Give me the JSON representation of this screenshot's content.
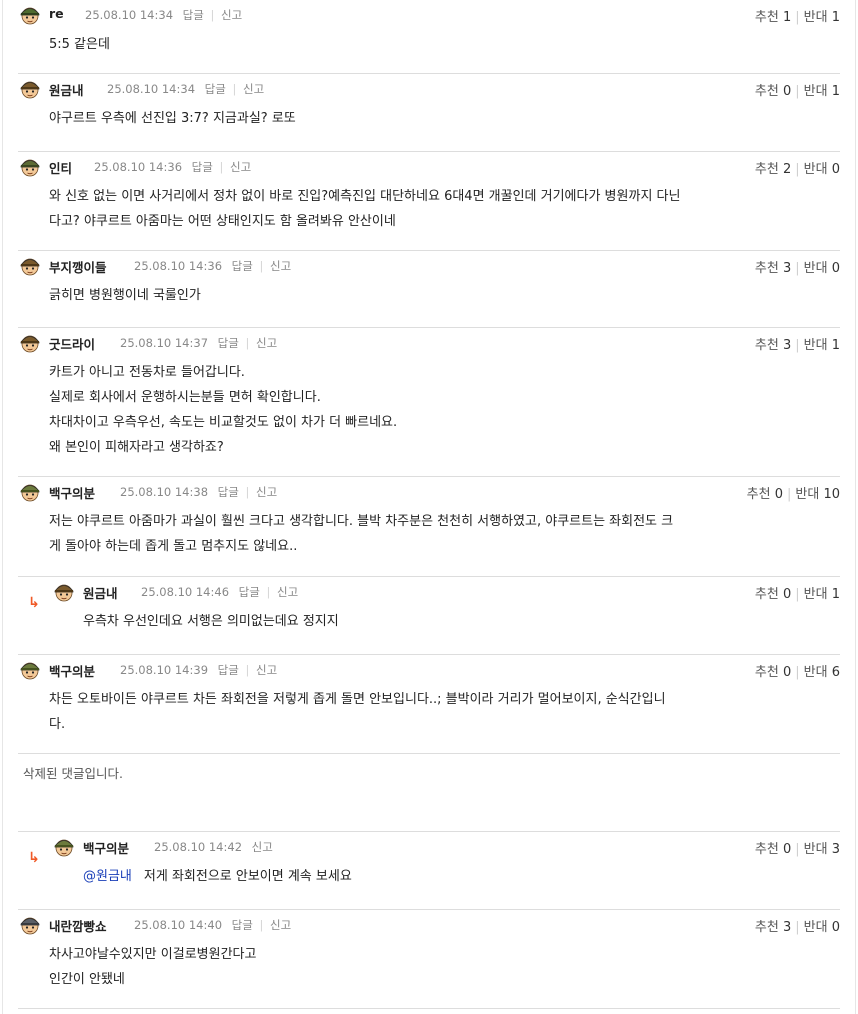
{
  "action_labels": {
    "reply": "답글",
    "report": "신고"
  },
  "vote_labels": {
    "up": "추천",
    "down": "반대"
  },
  "deleted_text": "삭제된 댓글입니다.",
  "comments": [
    {
      "nick": "re",
      "avatar": "soldier-green-helmet",
      "time": "25.08.10 14:34",
      "up": 1,
      "down": 1,
      "lines": [
        "5:5 같은데"
      ]
    },
    {
      "nick": "원금내",
      "avatar": "soldier-brown-helmet",
      "time": "25.08.10 14:34",
      "up": 0,
      "down": 1,
      "lines": [
        "야구르트 우측에 선진입 3:7? 지금과실? 로또"
      ]
    },
    {
      "nick": "인티",
      "avatar": "soldier-green-cap",
      "time": "25.08.10 14:36",
      "up": 2,
      "down": 0,
      "lines": [
        "와 신호 없는 이면 사거리에서 정차 없이 바로 진입?예측진입 대단하네요 6대4면 개꿀인데 거기에다가 병원까지 다닌",
        "다고? 야쿠르트 아줌마는 어떤 상태인지도 함 올려봐유 안산이네"
      ]
    },
    {
      "nick": "부지깽이들",
      "avatar": "soldier-brown-helmet",
      "time": "25.08.10 14:36",
      "up": 3,
      "down": 0,
      "lines": [
        "긁히면 병원행이네 국룰인가"
      ]
    },
    {
      "nick": "굿드라이",
      "avatar": "soldier-brown-helmet",
      "time": "25.08.10 14:37",
      "up": 3,
      "down": 1,
      "lines": [
        "카트가 아니고 전동차로 들어갑니다.",
        "실제로 회사에서 운행하시는분들 면허 확인합니다.",
        "차대차이고 우측우선, 속도는 비교할것도 없이 차가 더 빠르네요.",
        "왜 본인이 피해자라고 생각하죠?"
      ]
    },
    {
      "nick": "백구의분",
      "avatar": "soldier-olive-helmet",
      "time": "25.08.10 14:38",
      "up": 0,
      "down": 10,
      "lines": [
        "저는 야쿠르트 아줌마가 과실이 훨씬 크다고 생각합니다. 블박 차주분은 천천히 서행하였고, 야쿠르트는 좌회전도 크",
        "게 돌아야 하는데 좁게 돌고 멈추지도 않네요.."
      ]
    },
    {
      "nick": "원금내",
      "avatar": "soldier-brown-helmet",
      "time": "25.08.10 14:46",
      "up": 0,
      "down": 1,
      "reply": true,
      "lines": [
        "우측차 우선인데요 서행은 의미없는데요 정지지"
      ]
    },
    {
      "nick": "백구의분",
      "avatar": "soldier-olive-helmet",
      "time": "25.08.10 14:39",
      "up": 0,
      "down": 6,
      "lines": [
        "차든 오토바이든 야쿠르트 차든 좌회전을 저렇게 좁게 돌면 안보입니다..; 블박이라 거리가 멀어보이지, 순식간입니",
        "다."
      ]
    },
    {
      "nick": "백구의분",
      "avatar": "soldier-olive-helmet",
      "time": "25.08.10 14:42",
      "up": 0,
      "down": 3,
      "reply": true,
      "report_only": true,
      "mention": "@원금내",
      "lines": [
        "저게 좌회전으로 안보이면 계속 보세요"
      ]
    },
    {
      "nick": "내란깜빵쇼",
      "avatar": "soldier-gray-helmet",
      "time": "25.08.10 14:40",
      "up": 3,
      "down": 0,
      "lines": [
        "차사고야날수있지만 이걸로병원간다고",
        "인간이 안됐네"
      ]
    }
  ]
}
